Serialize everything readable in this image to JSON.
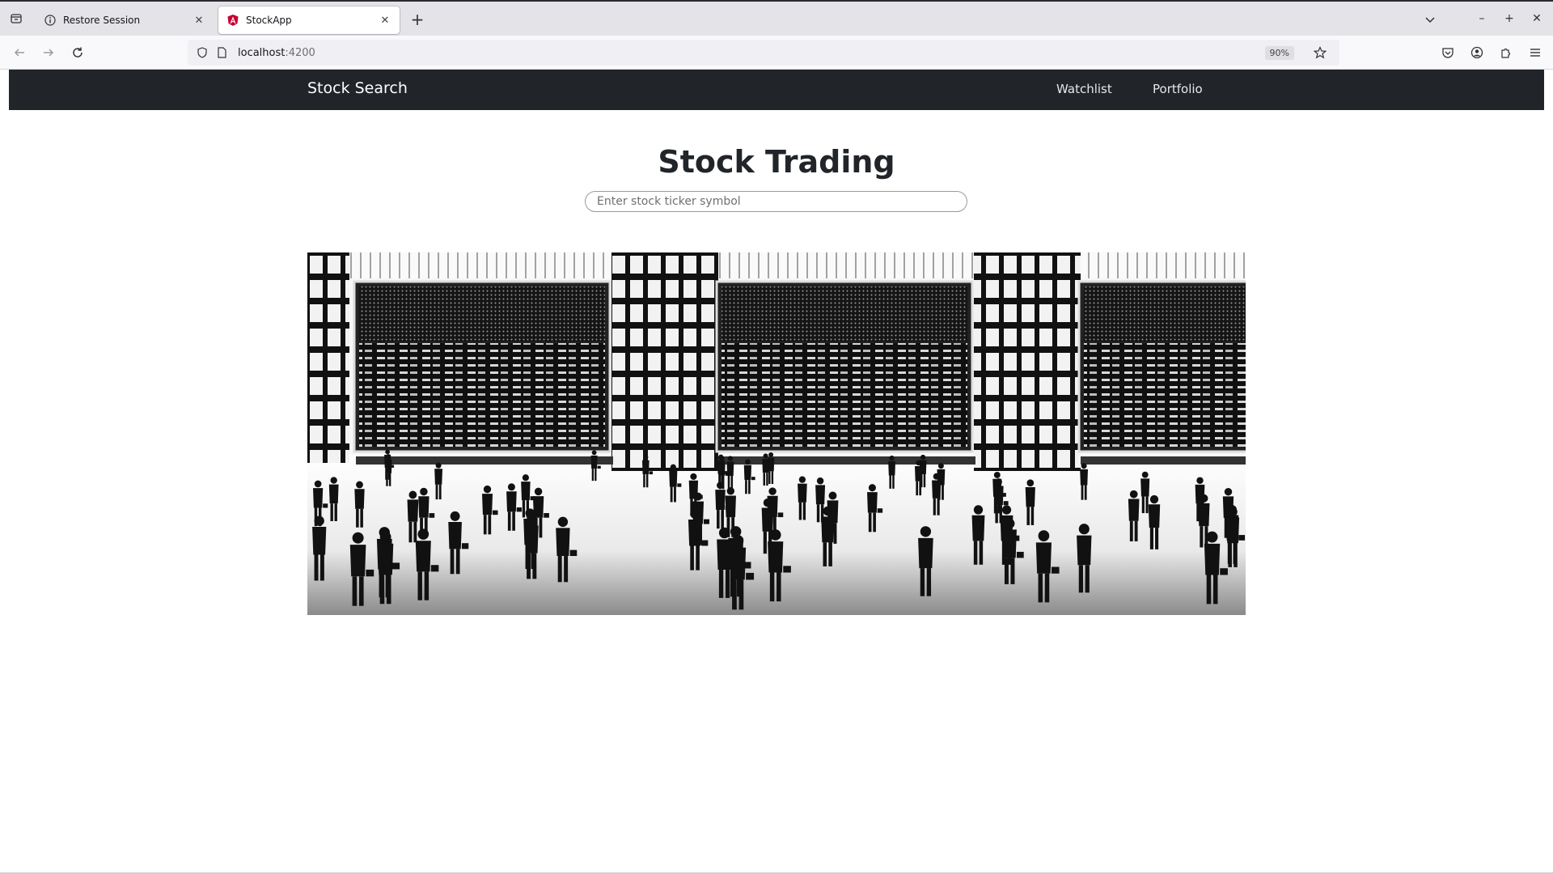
{
  "browser": {
    "tabs": [
      {
        "title": "Restore Session",
        "active": false,
        "icon": "info-icon"
      },
      {
        "title": "StockApp",
        "active": true,
        "icon": "angular-icon"
      }
    ],
    "url": {
      "host": "localhost",
      "port": ":4200"
    },
    "zoom": "90%"
  },
  "app": {
    "brand": "Stock Search",
    "nav": {
      "watchlist": "Watchlist",
      "portfolio": "Portfolio"
    },
    "title": "Stock Trading",
    "search": {
      "placeholder": "Enter stock ticker symbol",
      "value": ""
    },
    "hero_image": "stock-exchange-floor-illustration"
  },
  "colors": {
    "navbar_bg": "#212529",
    "page_bg": "#ffffff",
    "text": "#212529"
  }
}
